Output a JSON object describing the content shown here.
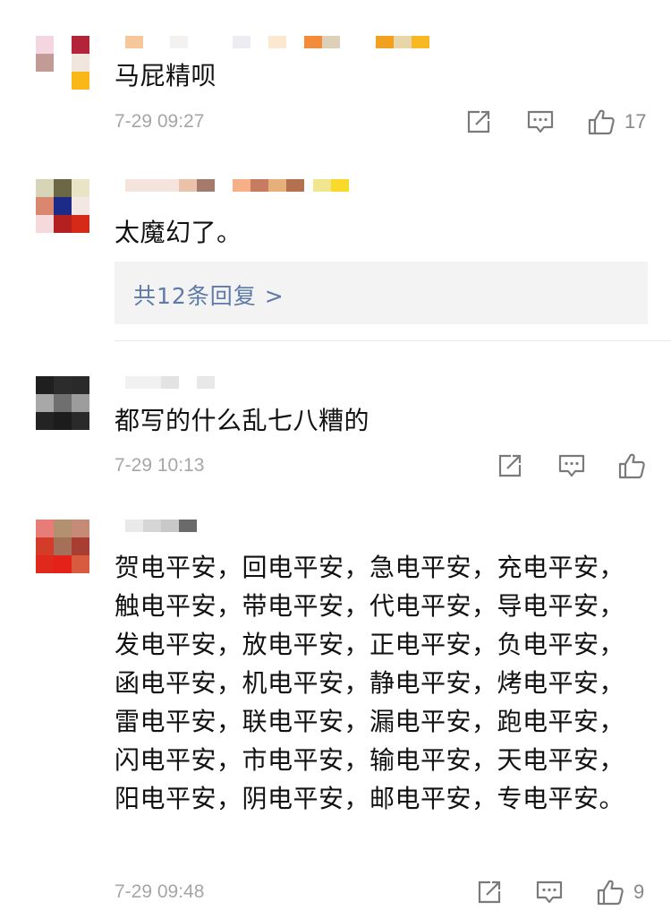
{
  "colors": {
    "text": "#111111",
    "meta": "#a6a6a6",
    "link": "#5d7aa8",
    "icon": "#7a7a7a",
    "reply_bg": "#f3f3f3"
  },
  "comments": [
    {
      "text": "马屁精呗",
      "time": "7-29 09:27",
      "likes": "17",
      "icons": [
        "share-icon",
        "comment-icon",
        "like-icon"
      ]
    },
    {
      "text": "太魔幻了。",
      "replies_link": "共12条回复 >"
    },
    {
      "text": "都写的什么乱七八糟的",
      "time": "7-29 10:13",
      "likes": ""
    },
    {
      "text": "贺电平安，回电平安，急电平安，充电平安，触电平安，带电平安，代电平安，导电平安，发电平安，放电平安，正电平安，负电平安，函电平安，机电平安，静电平安，烤电平安，雷电平安，联电平安，漏电平安，跑电平安，闪电平安，市电平安，输电平安，天电平安，阳电平安，阴电平安，邮电平安，专电平安。",
      "time": "7-29 09:48",
      "likes": "9"
    }
  ]
}
